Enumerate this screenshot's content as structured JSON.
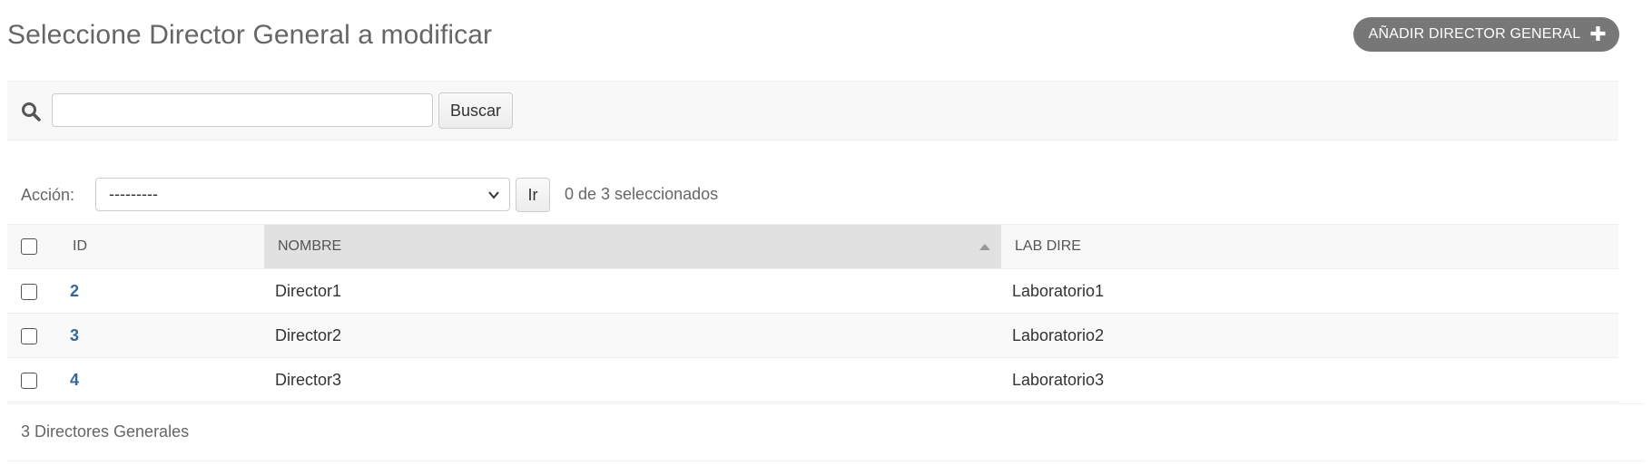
{
  "header": {
    "title": "Seleccione Director General a modificar",
    "add_button_label": "AÑADIR DIRECTOR GENERAL",
    "add_icon": "plus-icon"
  },
  "search": {
    "icon": "search-icon",
    "value": "",
    "placeholder": "",
    "button_label": "Buscar"
  },
  "actions": {
    "label": "Acción:",
    "selected_value": "---------",
    "go_label": "Ir",
    "selection_counter": "0 de 3 seleccionados"
  },
  "table": {
    "columns": [
      "ID",
      "NOMBRE",
      "LAB DIRE"
    ],
    "sorted_column": "NOMBRE",
    "sort_direction": "ascending",
    "rows": [
      {
        "id": "2",
        "nombre": "Director1",
        "lab_dire": "Laboratorio1"
      },
      {
        "id": "3",
        "nombre": "Director2",
        "lab_dire": "Laboratorio2"
      },
      {
        "id": "4",
        "nombre": "Director3",
        "lab_dire": "Laboratorio3"
      }
    ]
  },
  "paginator": {
    "text": "3 Directores Generales"
  },
  "colors": {
    "link": "#336699",
    "button_dark": "#777777",
    "sorted_header": "#e1e1e1",
    "toolbar_bg": "#f8f8f8"
  }
}
